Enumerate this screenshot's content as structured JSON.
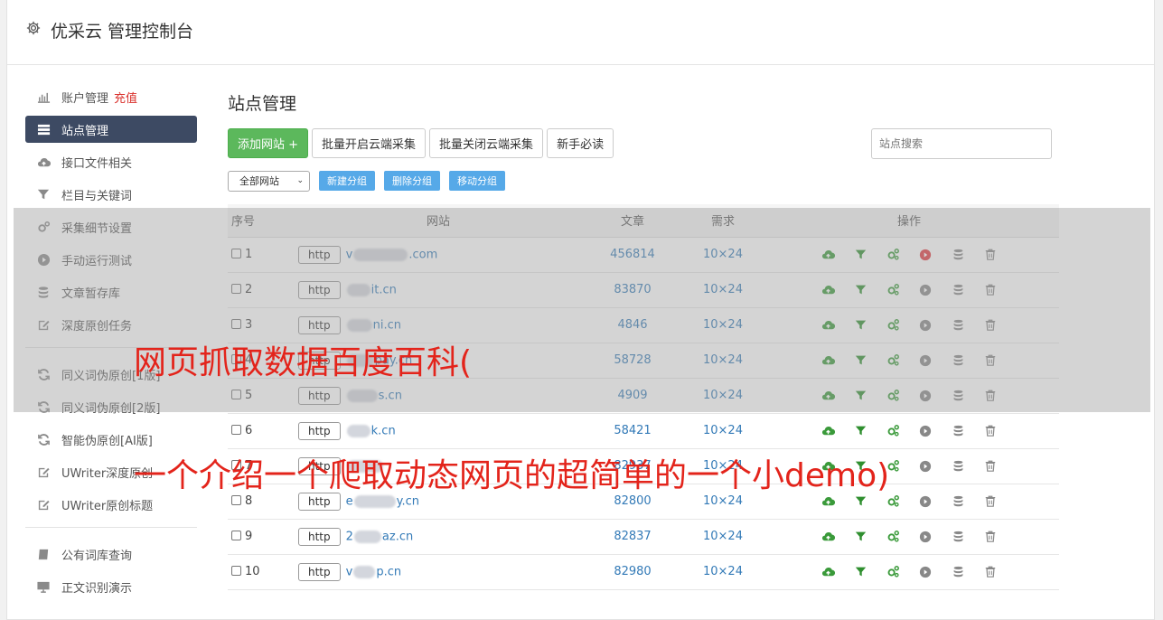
{
  "brand": {
    "title": "优采云 管理控制台",
    "icon": "gear-icon"
  },
  "sidebar": {
    "items": [
      {
        "label": "账户管理",
        "extra": "充值",
        "icon": "bar-chart-icon"
      },
      {
        "label": "站点管理",
        "icon": "list-icon",
        "active": true
      },
      {
        "label": "接口文件相关",
        "icon": "cloud-upload-icon"
      },
      {
        "label": "栏目与关键词",
        "icon": "filter-icon"
      },
      {
        "label": "采集细节设置",
        "icon": "cogs-icon"
      },
      {
        "label": "手动运行测试",
        "icon": "play-circle-icon"
      },
      {
        "label": "文章暂存库",
        "icon": "database-icon"
      },
      {
        "label": "深度原创任务",
        "icon": "edit-icon"
      }
    ],
    "items2": [
      {
        "label": "同义词伪原创[1版]",
        "icon": "refresh-icon"
      },
      {
        "label": "同义词伪原创[2版]",
        "icon": "refresh-icon"
      },
      {
        "label": "智能伪原创[AI版]",
        "icon": "refresh-icon"
      },
      {
        "label": "UWriter深度原创",
        "icon": "edit-icon"
      },
      {
        "label": "UWriter原创标题",
        "icon": "edit-icon"
      }
    ],
    "items3": [
      {
        "label": "公有词库查询",
        "icon": "book-icon"
      },
      {
        "label": "正文识别演示",
        "icon": "monitor-icon"
      }
    ]
  },
  "main": {
    "title": "站点管理",
    "toolbar": {
      "add": "添加网站 +",
      "batch_open": "批量开启云端采集",
      "batch_close": "批量关闭云端采集",
      "guide": "新手必读"
    },
    "search_placeholder": "站点搜索",
    "group_select": "全部网站",
    "group_buttons": {
      "new": "新建分组",
      "delete": "删除分组",
      "move": "移动分组"
    },
    "table": {
      "headers": {
        "idx": "序号",
        "site": "网站",
        "articles": "文章",
        "demand": "需求",
        "ops": "操作"
      },
      "rows": [
        {
          "idx": "1",
          "pre": "v",
          "suf": ".com",
          "articles": "456814",
          "demand": "10×24",
          "active": true
        },
        {
          "idx": "2",
          "pre": "",
          "suf": "it.cn",
          "articles": "83870",
          "demand": "10×24",
          "active": false
        },
        {
          "idx": "3",
          "pre": "",
          "suf": "ni.cn",
          "articles": "4846",
          "demand": "10×24",
          "active": false
        },
        {
          "idx": "4",
          "pre": "",
          "suf": "pay.cn",
          "articles": "58728",
          "demand": "10×24",
          "active": false
        },
        {
          "idx": "5",
          "pre": "",
          "suf": "s.cn",
          "articles": "4909",
          "demand": "10×24",
          "active": false
        },
        {
          "idx": "6",
          "pre": "",
          "suf": "k.cn",
          "articles": "58421",
          "demand": "10×24",
          "active": false
        },
        {
          "idx": "7",
          "pre": "",
          "suf": "",
          "articles": "82937",
          "demand": "10×24",
          "active": false
        },
        {
          "idx": "8",
          "pre": "e",
          "suf": "y.cn",
          "articles": "82800",
          "demand": "10×24",
          "active": false
        },
        {
          "idx": "9",
          "pre": "2",
          "suf": "az.cn",
          "articles": "82837",
          "demand": "10×24",
          "active": false
        },
        {
          "idx": "10",
          "pre": "v",
          "suf": "p.cn",
          "articles": "82980",
          "demand": "10×24",
          "active": false
        }
      ],
      "http_label": "http"
    }
  },
  "overlay": {
    "line1": "网页抓取数据百度百科(",
    "line2": "一个介绍一个爬取动态网页的超简单的一个小demo)"
  },
  "colors": {
    "sidebar_active": "#3d4a63",
    "accent_green": "#5cb85c",
    "link_blue": "#337ab7",
    "overlay_red": "#e3241b"
  }
}
